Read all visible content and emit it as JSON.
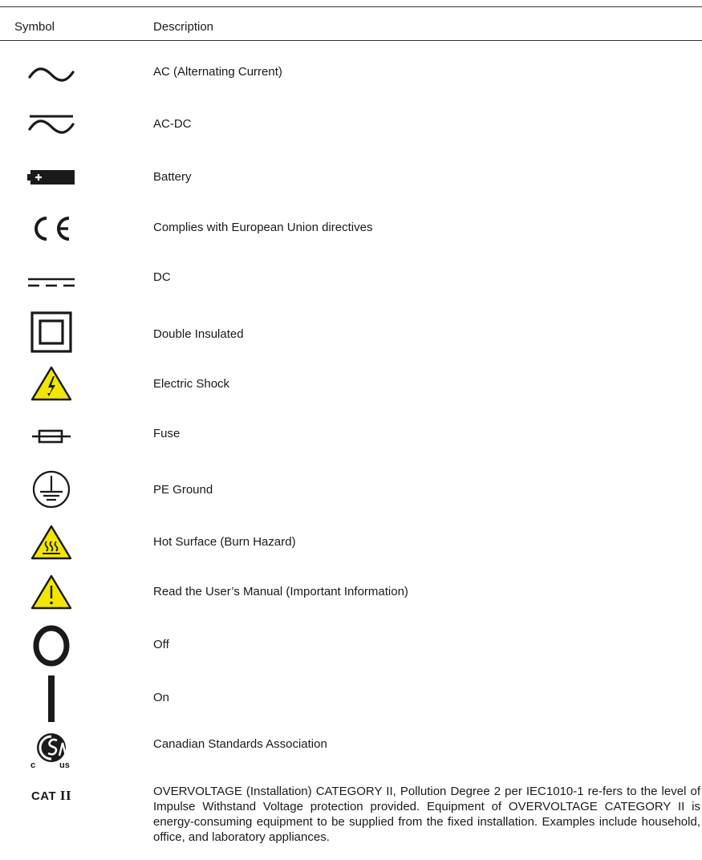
{
  "header": {
    "symbol_label": "Symbol",
    "description_label": "Description"
  },
  "rows": [
    {
      "icon": "ac-wave-icon",
      "description": "AC (Alternating Current)"
    },
    {
      "icon": "ac-dc-icon",
      "description": "AC-DC"
    },
    {
      "icon": "battery-icon",
      "description": "Battery"
    },
    {
      "icon": "ce-mark-icon",
      "description": "Complies with European Union directives"
    },
    {
      "icon": "dc-icon",
      "description": "DC"
    },
    {
      "icon": "double-insulated-icon",
      "description": "Double Insulated"
    },
    {
      "icon": "electric-shock-icon",
      "description": "Electric Shock"
    },
    {
      "icon": "fuse-icon",
      "description": "Fuse"
    },
    {
      "icon": "pe-ground-icon",
      "description": "PE Ground"
    },
    {
      "icon": "hot-surface-icon",
      "description": "Hot Surface (Burn Hazard)"
    },
    {
      "icon": "warning-icon",
      "description": "Read the User’s Manual (Important Information)"
    },
    {
      "icon": "off-icon",
      "description": "Off"
    },
    {
      "icon": "on-icon",
      "description": "On"
    },
    {
      "icon": "csa-icon",
      "description": "Canadian Standards Association",
      "icon_text_left": "c",
      "icon_text_right": "us"
    },
    {
      "icon": "cat-ii-icon",
      "description": "OVERVOLTAGE (Installation) CATEGORY II, Pollution Degree 2 per IEC1010-1 re-fers to the level of Impulse Withstand Voltage protection provided. Equipment of OVERVOLTAGE CATEGORY II is energy-consuming equipment to be supplied from the fixed installation. Examples include household, office, and laboratory appliances.",
      "icon_text": "CAT",
      "icon_numeral": "II"
    }
  ],
  "colors": {
    "warning_yellow": "#f2e600",
    "ink": "#1a1a1a"
  }
}
